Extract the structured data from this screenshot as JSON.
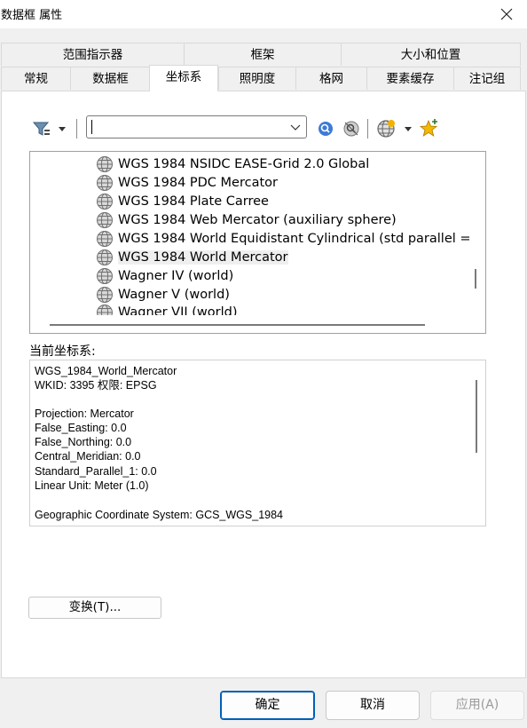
{
  "window": {
    "title": "数据框 属性",
    "close_icon": "close-icon"
  },
  "tabs": {
    "row1": [
      {
        "label": "范围指示器"
      },
      {
        "label": "框架"
      },
      {
        "label": "大小和位置"
      }
    ],
    "row2": [
      {
        "label": "常规"
      },
      {
        "label": "数据框"
      },
      {
        "label": "坐标系",
        "active": true
      },
      {
        "label": "照明度"
      },
      {
        "label": "格网"
      },
      {
        "label": "要素缓存"
      },
      {
        "label": "注记组"
      }
    ]
  },
  "toolbar": {
    "filter_icon": "filter-icon",
    "search": {
      "value": "",
      "placeholder": ""
    },
    "search_icon": "search-icon",
    "clear_search_icon": "clear-search-icon",
    "add_coordinate_system_icon": "globe-add-icon",
    "favorites_icon": "add-to-favorites-icon"
  },
  "coordinate_systems": {
    "items": [
      {
        "label": "WGS 1984 NSIDC EASE-Grid 2.0 Global"
      },
      {
        "label": "WGS 1984 PDC Mercator"
      },
      {
        "label": "WGS 1984 Plate Carree"
      },
      {
        "label": "WGS 1984 Web Mercator (auxiliary sphere)"
      },
      {
        "label": "WGS 1984 World Equidistant Cylindrical (std parallel ="
      },
      {
        "label": "WGS 1984 World Mercator",
        "selected": true
      },
      {
        "label": "Wagner IV (world)"
      },
      {
        "label": "Wagner V (world)"
      },
      {
        "label": "Wagner VII (world)"
      }
    ]
  },
  "current": {
    "label": "当前坐标系:",
    "lines": [
      "WGS_1984_World_Mercator",
      "WKID: 3395 权限: EPSG",
      "",
      "Projection: Mercator",
      "False_Easting: 0.0",
      "False_Northing: 0.0",
      "Central_Meridian: 0.0",
      "Standard_Parallel_1: 0.0",
      "Linear Unit: Meter (1.0)",
      "",
      "Geographic Coordinate System: GCS_WGS_1984"
    ]
  },
  "buttons": {
    "transform": "变换(T)...",
    "ok": "确定",
    "cancel": "取消",
    "apply": "应用(A)"
  },
  "colors": {
    "accent": "#005fb8",
    "globe": "#8a8a8a",
    "star": "#f5b800"
  }
}
